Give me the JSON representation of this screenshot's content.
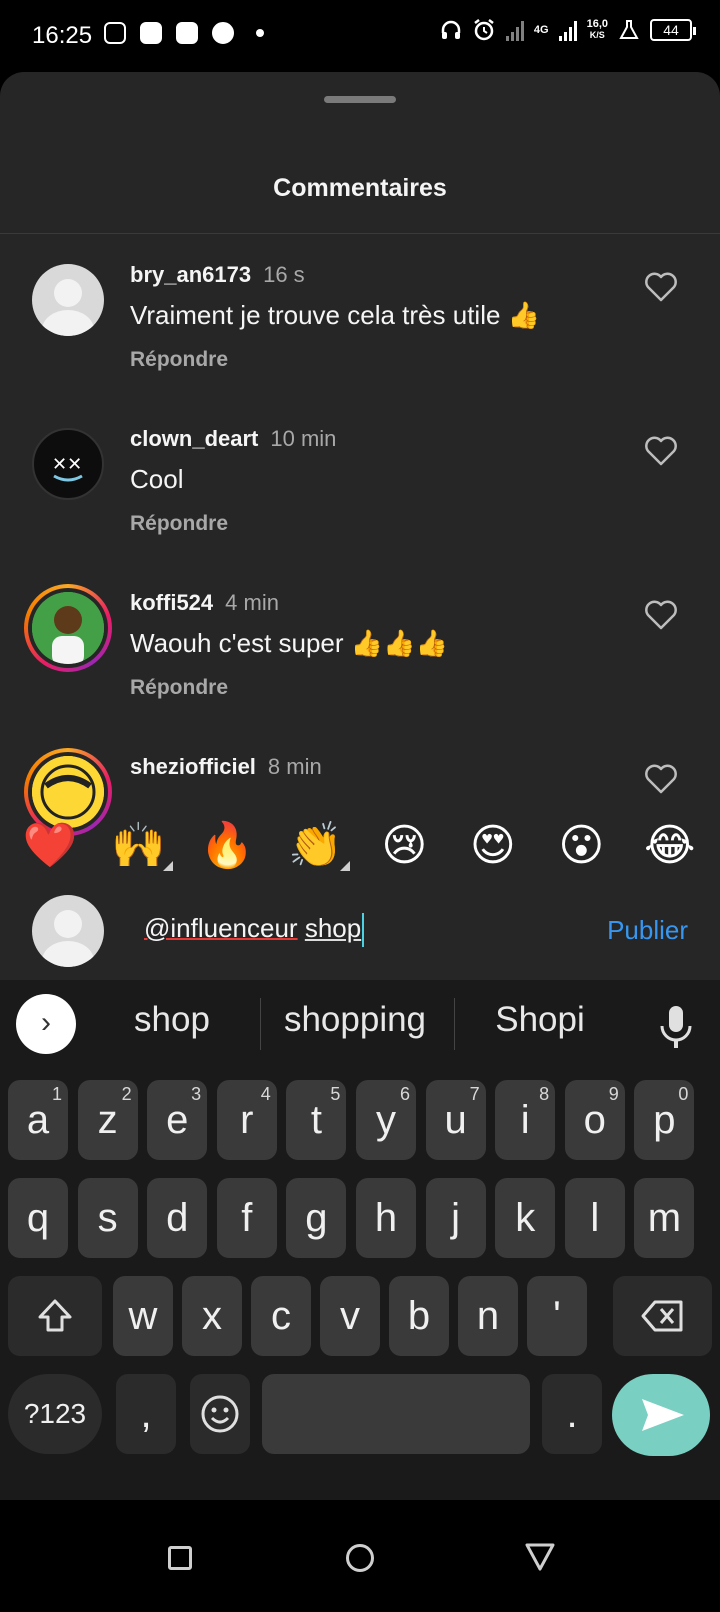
{
  "status_bar": {
    "time": "16:25",
    "network": "4G",
    "speed_value": "16,0",
    "speed_unit": "K/S",
    "battery": "44",
    "icons": [
      "instagram-icon",
      "app-p-icon",
      "app-p-icon",
      "soccer-ball-icon",
      "dot-icon",
      "headphones-icon",
      "alarm-icon",
      "signal-icon",
      "signal-4g-icon",
      "lab-flask-icon",
      "battery-icon"
    ]
  },
  "sheet": {
    "title": "Commentaires"
  },
  "comments": [
    {
      "user": "bry_an6173",
      "time": "16 s",
      "text": "Vraiment je trouve cela très utile 👍",
      "reply": "Répondre"
    },
    {
      "user": "clown_deart",
      "time": "10 min",
      "text": "Cool",
      "reply": "Répondre"
    },
    {
      "user": "koffi524",
      "time": "4 min",
      "text": "Waouh c'est super 👍👍👍",
      "reply": "Répondre"
    },
    {
      "user": "sheziofficiel",
      "time": "8 min"
    }
  ],
  "emoji_bar": [
    "❤️",
    "🙌",
    "🔥",
    "👏",
    "😢",
    "😍",
    "😮",
    "😂"
  ],
  "composer": {
    "mention": "@influenceur",
    "word": "shop",
    "publish": "Publier"
  },
  "keyboard": {
    "suggestions": [
      "shop",
      "shopping",
      "Shopi"
    ],
    "row1": [
      {
        "k": "a",
        "n": "1"
      },
      {
        "k": "z",
        "n": "2"
      },
      {
        "k": "e",
        "n": "3"
      },
      {
        "k": "r",
        "n": "4"
      },
      {
        "k": "t",
        "n": "5"
      },
      {
        "k": "y",
        "n": "6"
      },
      {
        "k": "u",
        "n": "7"
      },
      {
        "k": "i",
        "n": "8"
      },
      {
        "k": "o",
        "n": "9"
      },
      {
        "k": "p",
        "n": "0"
      }
    ],
    "row2": [
      "q",
      "s",
      "d",
      "f",
      "g",
      "h",
      "j",
      "k",
      "l",
      "m"
    ],
    "row3": [
      "w",
      "x",
      "c",
      "v",
      "b",
      "n",
      "'"
    ],
    "symbols": "?123",
    "comma": ",",
    "period": "."
  },
  "colors": {
    "sheet_bg": "#262626",
    "publish": "#3797f0",
    "send_key": "#79cfc1"
  }
}
